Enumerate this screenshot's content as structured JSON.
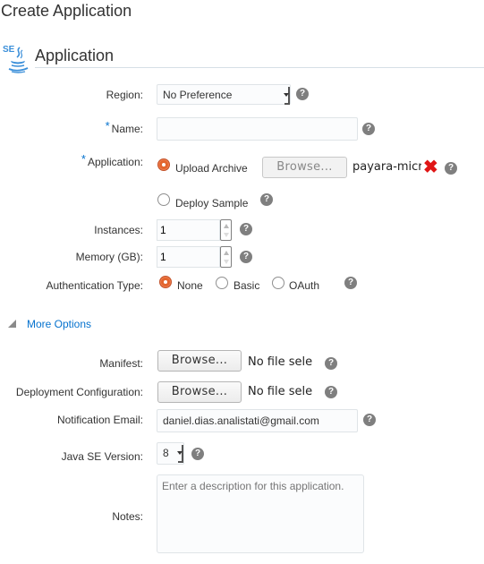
{
  "page": {
    "title": "Create Application"
  },
  "section": {
    "title": "Application",
    "icon": "java-se-icon",
    "icon_text": "SE"
  },
  "fields": {
    "region": {
      "label": "Region:",
      "value": "No Preference"
    },
    "name": {
      "label": "Name:",
      "required_mark": "*",
      "value": ""
    },
    "application": {
      "label": "Application:",
      "required_mark": "*",
      "options": [
        {
          "label": "Upload Archive",
          "checked": true
        },
        {
          "label": "Deploy Sample",
          "checked": false
        }
      ],
      "browse_label": "Browse...",
      "file_name": "payara-micro",
      "remove_icon": "✖"
    },
    "instances": {
      "label": "Instances:",
      "value": "1"
    },
    "memory": {
      "label": "Memory (GB):",
      "value": "1"
    },
    "auth": {
      "label": "Authentication Type:",
      "options": [
        {
          "label": "None",
          "checked": true
        },
        {
          "label": "Basic",
          "checked": false
        },
        {
          "label": "OAuth",
          "checked": false
        }
      ]
    },
    "more_options": {
      "label": "More Options",
      "expanded": true
    },
    "manifest": {
      "label": "Manifest:",
      "browse_label": "Browse...",
      "file_status": "No file sele"
    },
    "deployment_config": {
      "label": "Deployment Configuration:",
      "browse_label": "Browse...",
      "file_status": "No file sele"
    },
    "notification_email": {
      "label": "Notification Email:",
      "value": "daniel.dias.analistati@gmail.com"
    },
    "java_version": {
      "label": "Java SE Version:",
      "value": "8"
    },
    "notes": {
      "label": "Notes:",
      "value": "",
      "placeholder": "Enter a description for this application."
    }
  },
  "help_glyph": "?",
  "colors": {
    "accent_blue": "#0572ce",
    "radio_selected": "#e3652e",
    "remove_red": "#e01515",
    "help_gray": "#7f7f7f"
  }
}
